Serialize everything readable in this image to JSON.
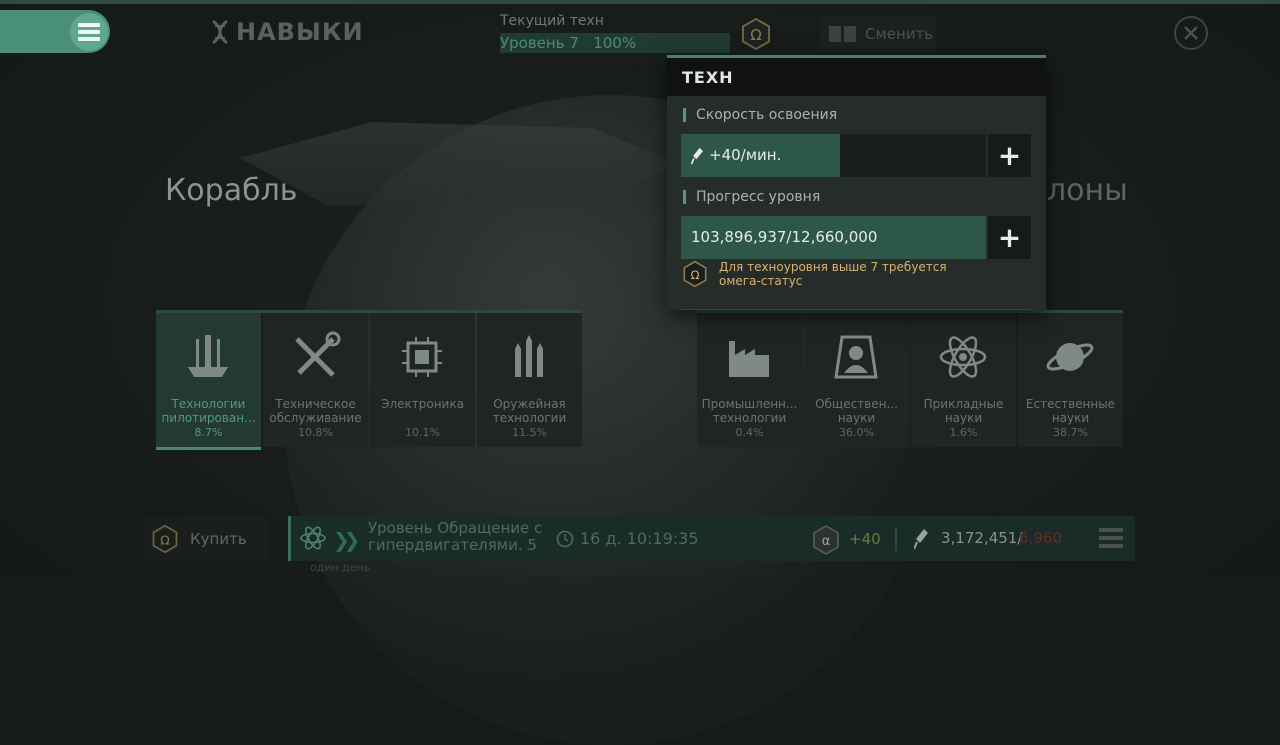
{
  "header": {
    "title": "НАВЫКИ",
    "current_tech_label": "Текущий техн",
    "current_tech_level": "Уровень 7",
    "current_tech_percent": "100%",
    "switch_label": "Сменить"
  },
  "sides": {
    "left": "Корабль",
    "right": "лоны"
  },
  "tiles_left": [
    {
      "name": "Технологии пилотирован...",
      "pct": "8.7%",
      "icon": "pilot-icon"
    },
    {
      "name": "Техническое обслуживание",
      "pct": "10.8%",
      "icon": "tools-icon"
    },
    {
      "name": "Электроника",
      "pct": "10.1%",
      "icon": "chip-icon"
    },
    {
      "name": "Оружейная технологии",
      "pct": "11.5%",
      "icon": "missiles-icon"
    }
  ],
  "tiles_right": [
    {
      "name": "Промышленн... технологии",
      "pct": "0.4%",
      "icon": "factory-icon"
    },
    {
      "name": "Обществен... науки",
      "pct": "36.0%",
      "icon": "person-icon"
    },
    {
      "name": "Прикладные науки",
      "pct": "1.6%",
      "icon": "atom-icon"
    },
    {
      "name": "Естественные науки",
      "pct": "38.7%",
      "icon": "planet-icon"
    }
  ],
  "bottom": {
    "buy_label": "Купить",
    "queue_line1": "Уровень Обращение с",
    "queue_line2": "гипердвигателями. 5",
    "time": "16 д. 10:19:35",
    "rate": "+40",
    "resource": "3,172,451/",
    "resource_max": "6,960",
    "one_day": "один день"
  },
  "popup": {
    "title": "ТЕХН",
    "speed_label": "Скорость освоения",
    "speed_value": "+40/мин.",
    "speed_fill": 0.52,
    "progress_label": "Прогресс уровня",
    "progress_value": "103,896,937/12,660,000",
    "progress_fill": 1.0,
    "warning": "Для техноуровня выше 7 требуется омега-статус"
  },
  "colors": {
    "accent": "#4f9a80",
    "warning": "#d8b56a"
  }
}
